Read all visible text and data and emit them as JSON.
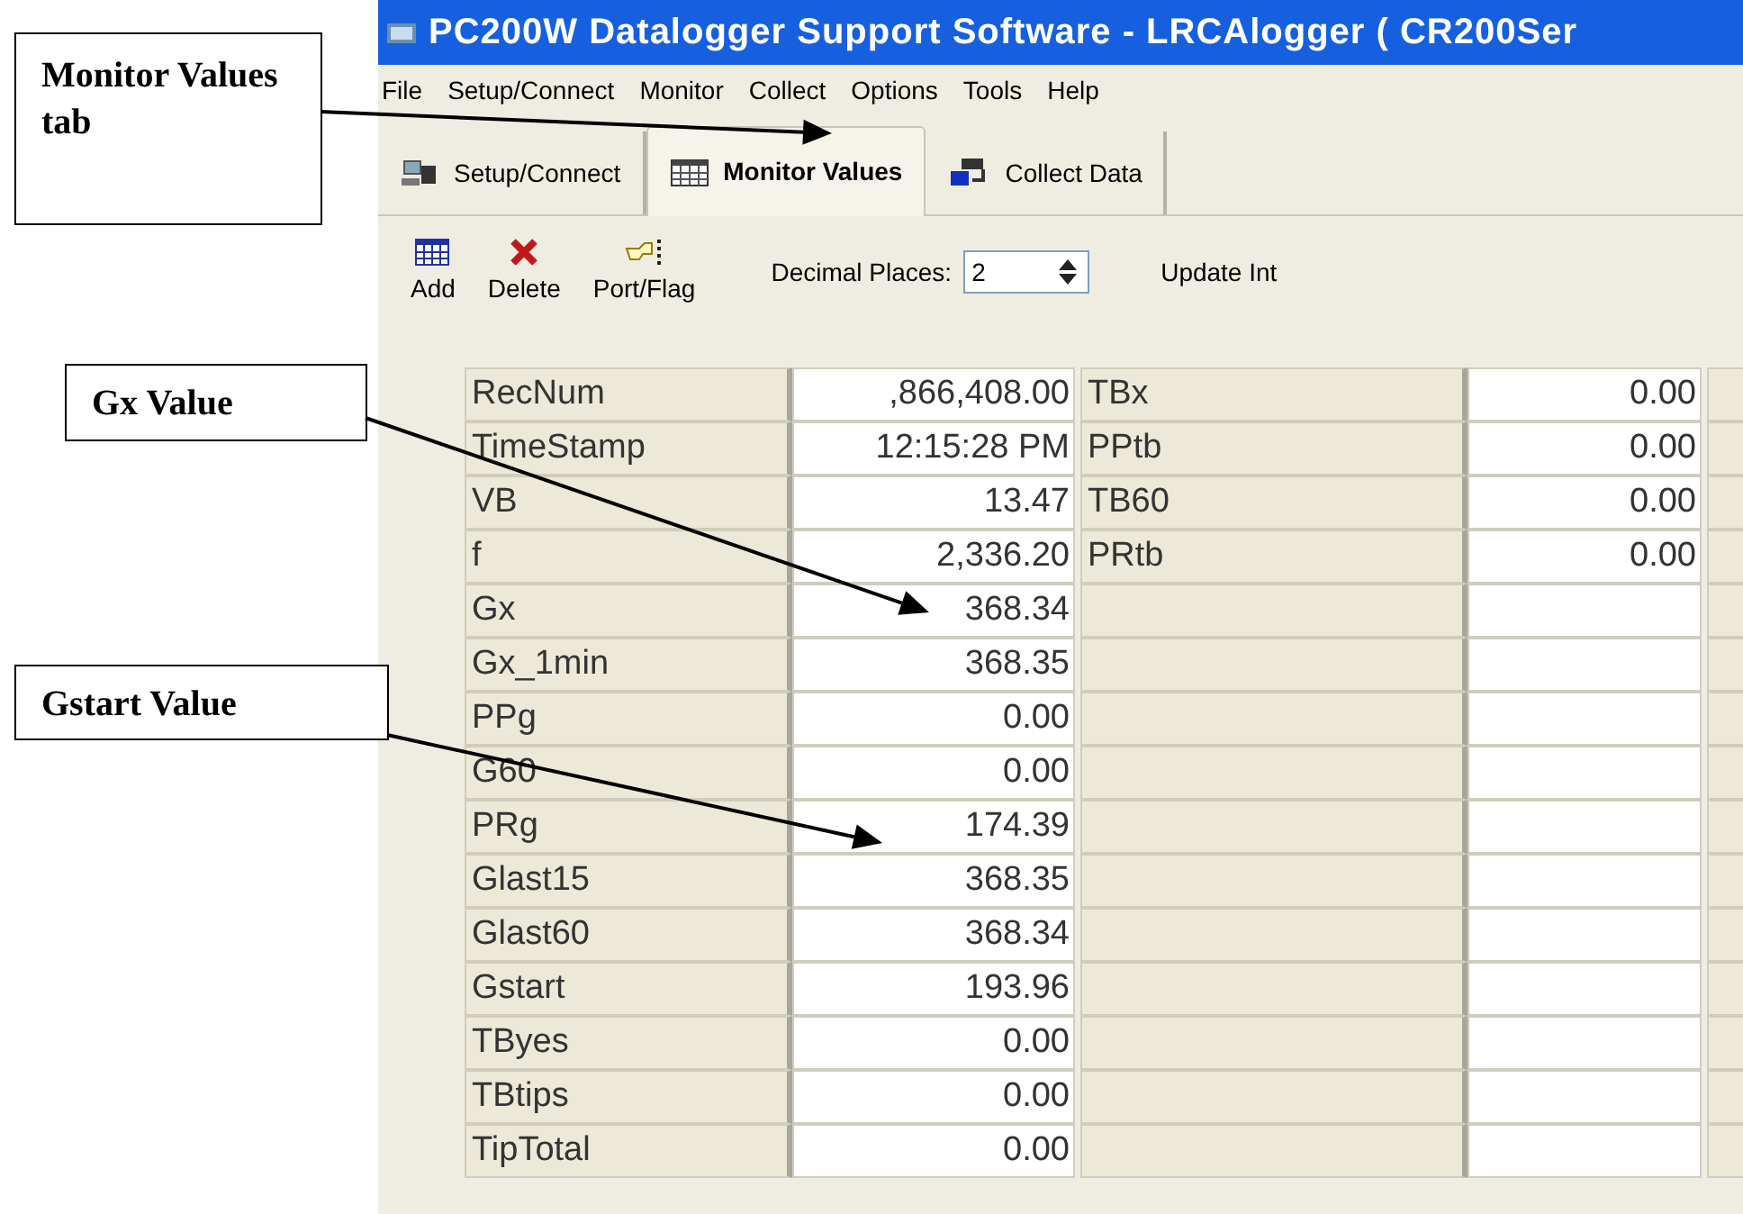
{
  "window": {
    "title": "PC200W Datalogger Support Software - LRCAlogger ( CR200Ser"
  },
  "menu": [
    "File",
    "Setup/Connect",
    "Monitor",
    "Collect",
    "Options",
    "Tools",
    "Help"
  ],
  "tabs": [
    {
      "label": "Setup/Connect",
      "selected": false,
      "kind": "setup"
    },
    {
      "label": "Monitor Values",
      "selected": true,
      "kind": "monitor"
    },
    {
      "label": "Collect Data",
      "selected": false,
      "kind": "collect"
    }
  ],
  "toolbar": {
    "buttons": [
      {
        "label": "Add",
        "kind": "add"
      },
      {
        "label": "Delete",
        "kind": "delete"
      },
      {
        "label": "Port/Flag",
        "kind": "port"
      }
    ],
    "decimal_places": {
      "label": "Decimal Places:",
      "value": "2"
    },
    "update_interval_label": "Update Int"
  },
  "table": {
    "rows": [
      {
        "name": "RecNum",
        "value": ",866,408.00",
        "name_2": "TBx",
        "value_2": "0.00"
      },
      {
        "name": "TimeStamp",
        "value": "12:15:28 PM",
        "name_2": "PPtb",
        "value_2": "0.00"
      },
      {
        "name": "VB",
        "value": "13.47",
        "name_2": "TB60",
        "value_2": "0.00"
      },
      {
        "name": "f",
        "value": "2,336.20",
        "name_2": "PRtb",
        "value_2": "0.00"
      },
      {
        "name": "Gx",
        "value": "368.34"
      },
      {
        "name": "Gx_1min",
        "value": "368.35"
      },
      {
        "name": "PPg",
        "value": "0.00"
      },
      {
        "name": "G60",
        "value": "0.00"
      },
      {
        "name": "PRg",
        "value": "174.39"
      },
      {
        "name": "Glast15",
        "value": "368.35"
      },
      {
        "name": "Glast60",
        "value": "368.34"
      },
      {
        "name": "Gstart",
        "value": "193.96"
      },
      {
        "name": "TByes",
        "value": "0.00"
      },
      {
        "name": "TBtips",
        "value": "0.00"
      },
      {
        "name": "TipTotal",
        "value": "0.00"
      }
    ]
  },
  "annotations": [
    {
      "text": "Monitor Values tab"
    },
    {
      "text": "Gx Value"
    },
    {
      "text": "Gstart Value"
    }
  ]
}
